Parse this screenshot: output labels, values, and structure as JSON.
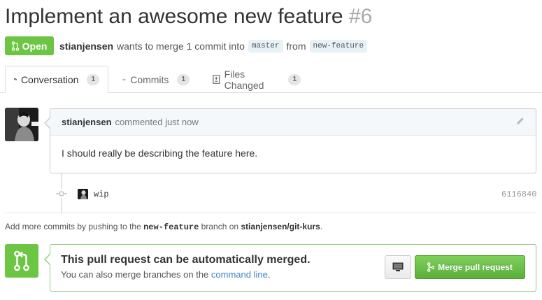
{
  "pr": {
    "title": "Implement an awesome new feature",
    "number": "#6",
    "state": "Open",
    "author": "stianjensen",
    "merge_text": "wants to merge 1 commit into",
    "base_branch": "master",
    "from_text": "from",
    "head_branch": "new-feature"
  },
  "tabs": [
    {
      "label": "Conversation",
      "count": "1",
      "icon": "comment-icon",
      "selected": true
    },
    {
      "label": "Commits",
      "count": "1",
      "icon": "commit-icon",
      "selected": false
    },
    {
      "label": "Files Changed",
      "count": "1",
      "icon": "file-diff-icon",
      "selected": false
    }
  ],
  "comment": {
    "author": "stianjensen",
    "action": "commented just now",
    "body": "I should really be describing the feature here."
  },
  "commit": {
    "message": "wip",
    "sha": "6116840"
  },
  "help": {
    "prefix": "Add more commits by pushing to the",
    "branch": "new-feature",
    "middle": "branch on",
    "repo": "stianjensen/git-kurs",
    "suffix": "."
  },
  "merge": {
    "title": "This pull request can be automatically merged.",
    "sub_prefix": "You can also merge branches on the",
    "sub_link": "command line",
    "sub_suffix": ".",
    "button_label": "Merge pull request"
  },
  "colors": {
    "open_green": "#6cc644",
    "link_blue": "#4183c4",
    "merge_border": "#95c97e"
  }
}
